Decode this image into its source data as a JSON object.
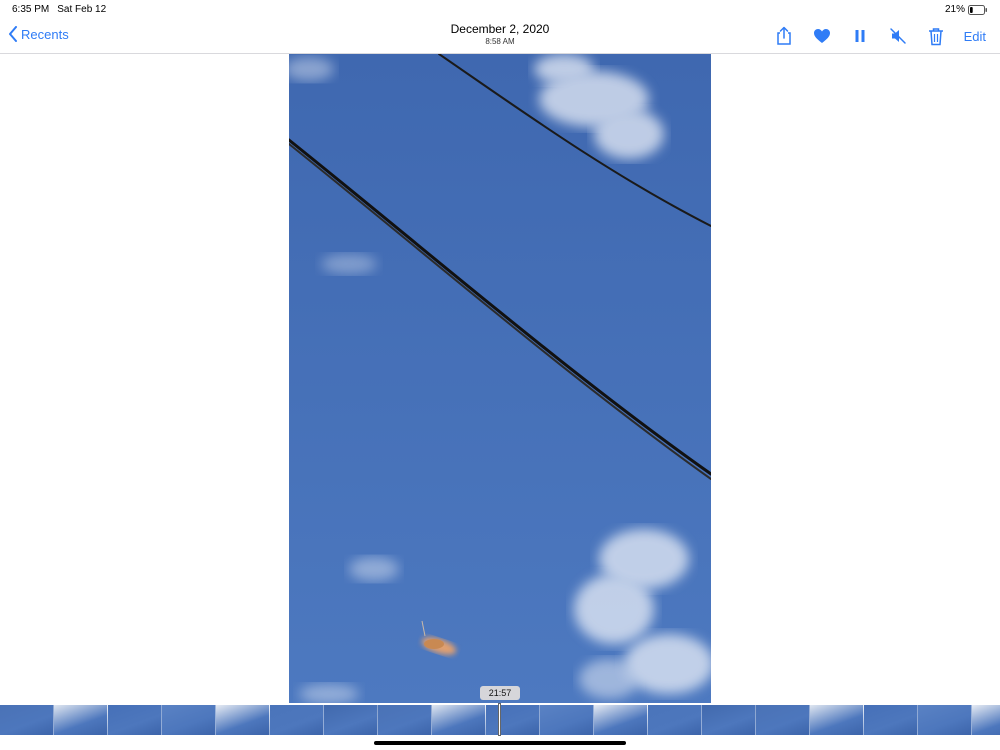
{
  "status_bar": {
    "time": "6:35 PM",
    "date": "Sat Feb 12",
    "battery": "21%",
    "battery_level": 0.21
  },
  "nav": {
    "back_label": "Recents",
    "title_date": "December 2, 2020",
    "title_time": "8:58 AM",
    "edit_label": "Edit",
    "actions": [
      "share-icon",
      "heart-icon",
      "pause-icon",
      "mute-icon",
      "trash-icon"
    ],
    "accent_color": "#2f7cf6"
  },
  "video": {
    "sky_color": "#4670b8"
  },
  "scrubber": {
    "current_time": "21:57",
    "playhead_color": "#ffffff"
  }
}
